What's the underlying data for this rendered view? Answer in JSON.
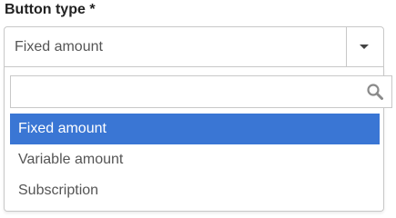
{
  "field": {
    "label": "Button type *"
  },
  "select": {
    "value": "Fixed amount",
    "toggle_icon": "caret-down-icon"
  },
  "search": {
    "value": "",
    "placeholder": "",
    "icon": "search-icon"
  },
  "options": [
    {
      "label": "Fixed amount",
      "selected": true
    },
    {
      "label": "Variable amount",
      "selected": false
    },
    {
      "label": "Subscription",
      "selected": false
    }
  ],
  "colors": {
    "highlight": "#3a76d4",
    "border": "#c8c8c8",
    "text": "#555555"
  }
}
